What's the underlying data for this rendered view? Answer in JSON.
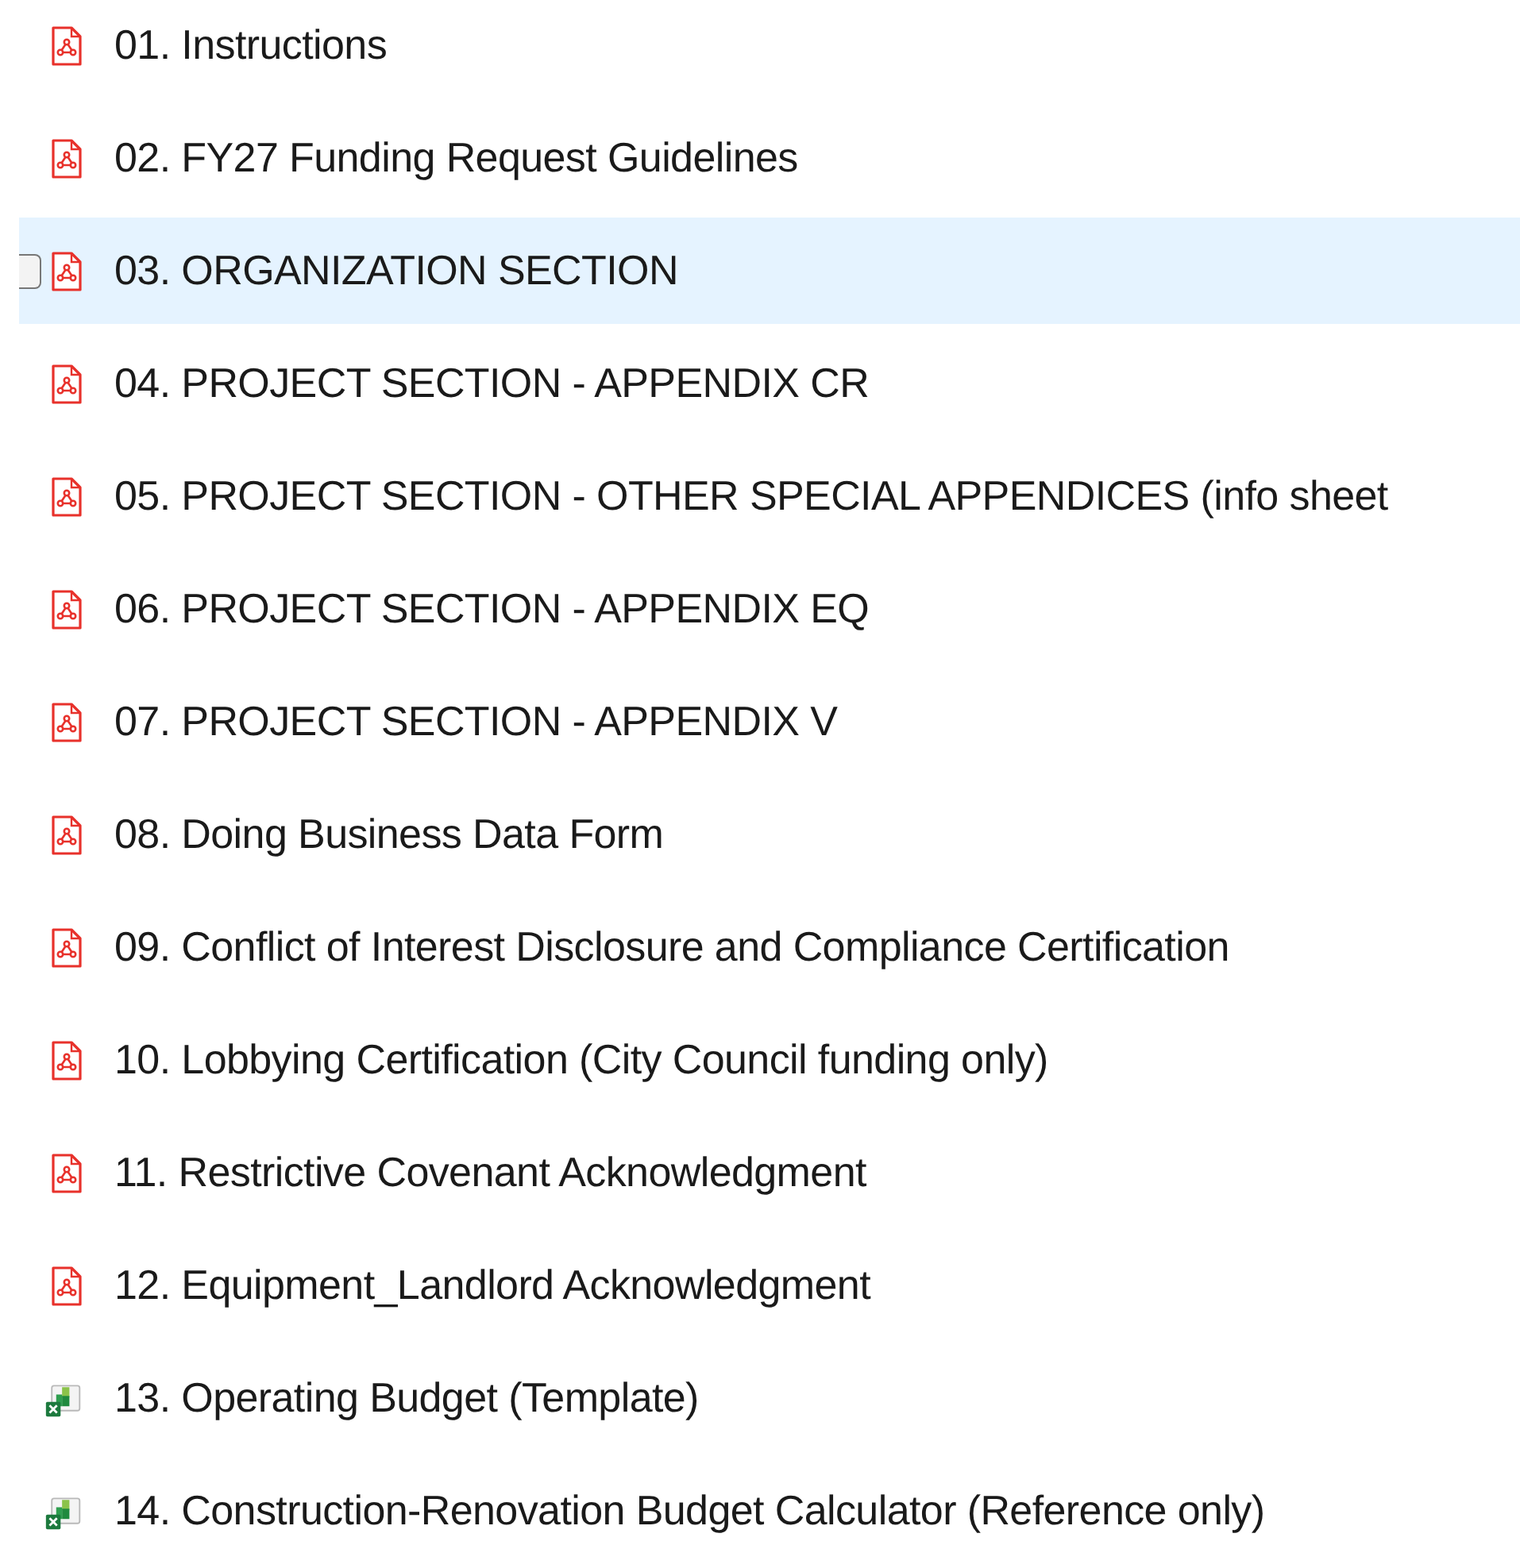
{
  "files": [
    {
      "name": "01. Instructions",
      "kind": "pdf",
      "selected": false
    },
    {
      "name": "02. FY27 Funding Request Guidelines",
      "kind": "pdf",
      "selected": false
    },
    {
      "name": "03. ORGANIZATION SECTION",
      "kind": "pdf",
      "selected": true,
      "checked": false
    },
    {
      "name": "04. PROJECT SECTION - APPENDIX CR",
      "kind": "pdf",
      "selected": false
    },
    {
      "name": "05. PROJECT SECTION - OTHER SPECIAL APPENDICES (info sheet",
      "kind": "pdf",
      "selected": false
    },
    {
      "name": "06. PROJECT SECTION - APPENDIX EQ",
      "kind": "pdf",
      "selected": false
    },
    {
      "name": "07. PROJECT SECTION - APPENDIX V",
      "kind": "pdf",
      "selected": false
    },
    {
      "name": "08. Doing Business Data Form",
      "kind": "pdf",
      "selected": false
    },
    {
      "name": "09. Conflict of Interest Disclosure and Compliance Certification",
      "kind": "pdf",
      "selected": false
    },
    {
      "name": "10. Lobbying Certification (City Council funding only)",
      "kind": "pdf",
      "selected": false
    },
    {
      "name": "11. Restrictive Covenant Acknowledgment",
      "kind": "pdf",
      "selected": false
    },
    {
      "name": "12. Equipment_Landlord Acknowledgment",
      "kind": "pdf",
      "selected": false
    },
    {
      "name": "13. Operating Budget (Template)",
      "kind": "excel",
      "selected": false
    },
    {
      "name": "14. Construction-Renovation Budget Calculator (Reference only)",
      "kind": "excel",
      "selected": false
    }
  ]
}
